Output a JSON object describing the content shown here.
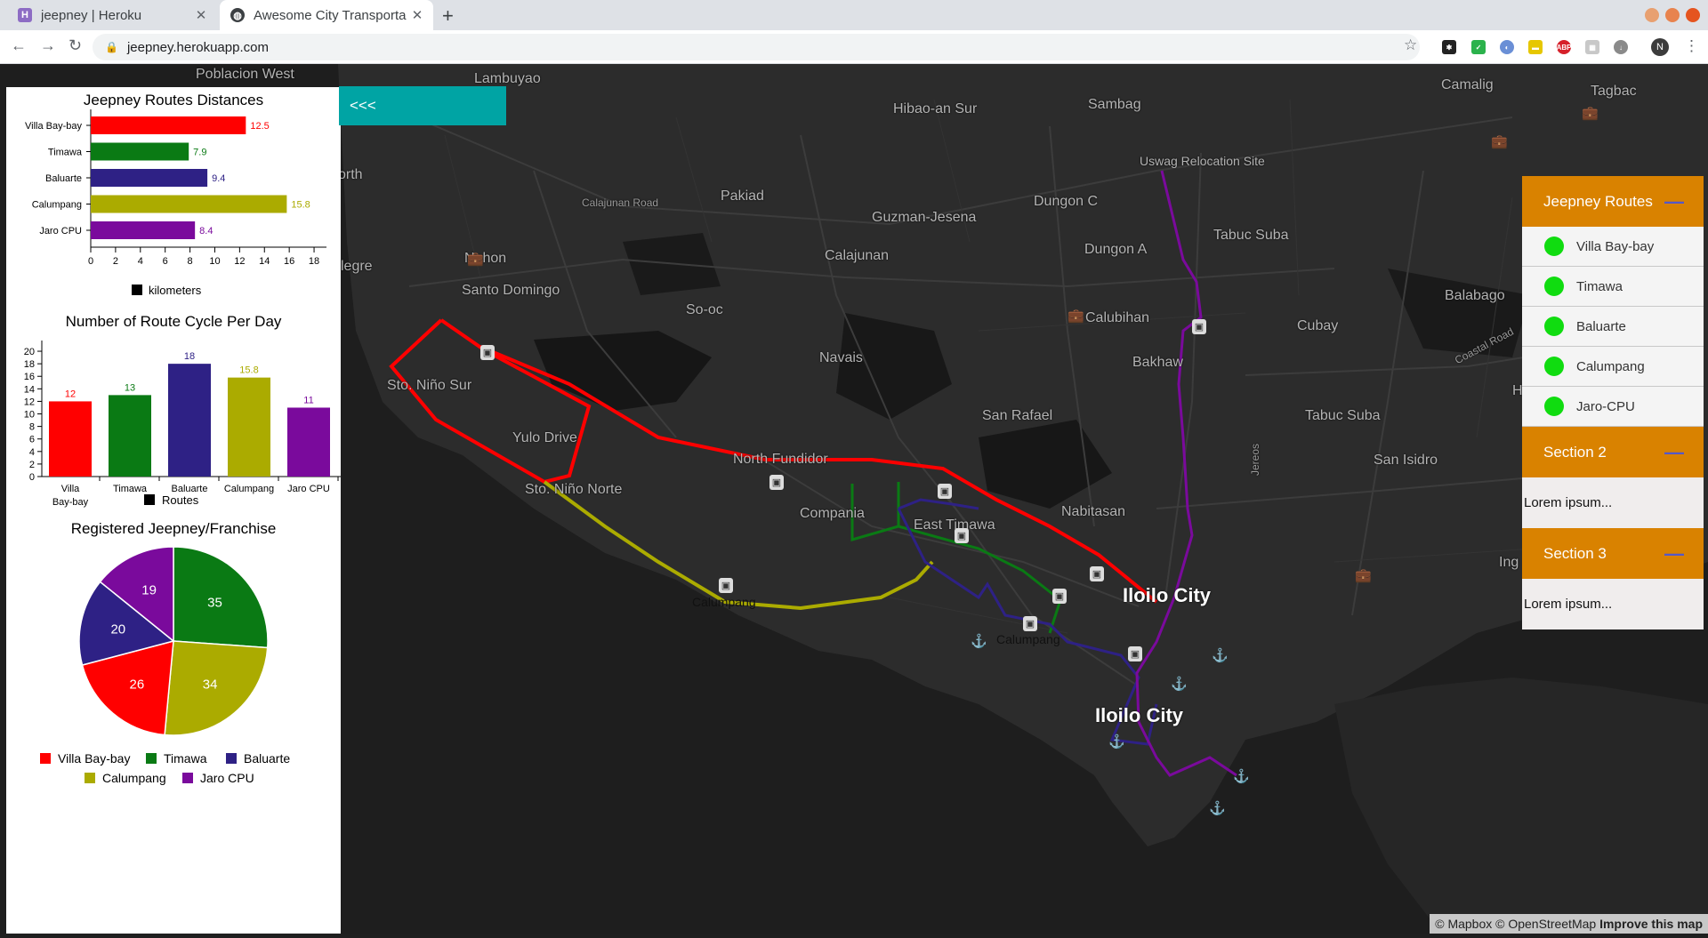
{
  "browser": {
    "tabs": [
      {
        "title": "jeepney | Heroku",
        "favicon": "heroku-icon",
        "active": false
      },
      {
        "title": "Awesome City Transporta",
        "favicon": "globe-icon",
        "active": true
      }
    ],
    "url": "jeepney.herokuapp.com",
    "avatar_letter": "N"
  },
  "map": {
    "places": [
      {
        "name": "Poblacion West",
        "cls": ""
      },
      {
        "name": "Lambuyao",
        "cls": ""
      },
      {
        "name": "Hibao-an Sur",
        "cls": ""
      },
      {
        "name": "Sambag",
        "cls": ""
      },
      {
        "name": "Camalig",
        "cls": ""
      },
      {
        "name": "Tagbac",
        "cls": ""
      },
      {
        "name": "Uswag Relocation Site",
        "cls": "small"
      },
      {
        "name": "orth",
        "cls": ""
      },
      {
        "name": "Pakiad",
        "cls": ""
      },
      {
        "name": "Calajunan Road",
        "cls": "road"
      },
      {
        "name": "Dungon C",
        "cls": ""
      },
      {
        "name": "Guzman-Jesena",
        "cls": ""
      },
      {
        "name": "Tabuc Suba",
        "cls": ""
      },
      {
        "name": "Calajunan",
        "cls": ""
      },
      {
        "name": "Dungon A",
        "cls": ""
      },
      {
        "name": "legre",
        "cls": ""
      },
      {
        "name": "Nahon",
        "cls": ""
      },
      {
        "name": "Santo Domingo",
        "cls": ""
      },
      {
        "name": "Balabago",
        "cls": ""
      },
      {
        "name": "So-oc",
        "cls": ""
      },
      {
        "name": "Calubihan",
        "cls": ""
      },
      {
        "name": "Cubay",
        "cls": ""
      },
      {
        "name": "Coastal Road",
        "cls": "road"
      },
      {
        "name": "Navais",
        "cls": ""
      },
      {
        "name": "Bakhaw",
        "cls": ""
      },
      {
        "name": "Sto. Niño Sur",
        "cls": ""
      },
      {
        "name": "Hinac",
        "cls": ""
      },
      {
        "name": "San Rafael",
        "cls": ""
      },
      {
        "name": "Tabuc Suba",
        "cls": ""
      },
      {
        "name": "Jereos",
        "cls": "road"
      },
      {
        "name": "Yulo Drive",
        "cls": ""
      },
      {
        "name": "North Fundidor",
        "cls": ""
      },
      {
        "name": "San Isidro",
        "cls": ""
      },
      {
        "name": "Sto. Niño Norte",
        "cls": ""
      },
      {
        "name": "Nabitasan",
        "cls": ""
      },
      {
        "name": "Compania",
        "cls": ""
      },
      {
        "name": "East Timawa",
        "cls": ""
      },
      {
        "name": "Ing",
        "cls": ""
      },
      {
        "name": "Iloilo City",
        "cls": "city"
      },
      {
        "name": "Calumpang",
        "cls": "term"
      },
      {
        "name": "Calumpang",
        "cls": "term"
      },
      {
        "name": "Iloilo City",
        "cls": "city"
      }
    ],
    "attribution_prefix": "© Mapbox © OpenStreetMap",
    "attribution_link": "Improve this map"
  },
  "panel_toggle_label": "<<<",
  "colors": {
    "Villa Bay-bay": "#ff0000",
    "Timawa": "#0a7a14",
    "Baluarte": "#2e2185",
    "Calumpang": "#abab00",
    "Jaro CPU": "#7a0a9c"
  },
  "chart_data": [
    {
      "type": "bar",
      "orientation": "horizontal",
      "title": "Jeepney Routes Distances",
      "categories": [
        "Villa Bay-bay",
        "Timawa",
        "Baluarte",
        "Calumpang",
        "Jaro CPU"
      ],
      "values": [
        12.5,
        7.9,
        9.4,
        15.8,
        8.4
      ],
      "xlim": [
        0,
        19
      ],
      "xticks": [
        0,
        2,
        4,
        6,
        8,
        10,
        12,
        14,
        16,
        18
      ],
      "legend": "kilometers",
      "legend_position": "bottom"
    },
    {
      "type": "bar",
      "orientation": "vertical",
      "title": "Number of Route Cycle Per Day",
      "categories": [
        "Villa Bay-bay",
        "Timawa",
        "Baluarte",
        "Calumpang",
        "Jaro CPU"
      ],
      "values": [
        12,
        13,
        18,
        15.8,
        11
      ],
      "ylim": [
        0,
        21
      ],
      "yticks": [
        0,
        2,
        4,
        6,
        8,
        10,
        12,
        14,
        16,
        18,
        20
      ],
      "legend": "Routes",
      "legend_position": "bottom"
    },
    {
      "type": "pie",
      "title": "Registered Jeepney/Franchise",
      "slices": [
        {
          "label": "Timawa",
          "value": 35
        },
        {
          "label": "Calumpang",
          "value": 34
        },
        {
          "label": "Villa Bay-bay",
          "value": 26
        },
        {
          "label": "Baluarte",
          "value": 20
        },
        {
          "label": "Jaro CPU",
          "value": 19
        }
      ],
      "legend": [
        "Villa Bay-bay",
        "Timawa",
        "Baluarte",
        "Calumpang",
        "Jaro CPU"
      ],
      "legend_position": "bottom"
    }
  ],
  "right_panel": {
    "sections": [
      {
        "title": "Jeepney Routes",
        "items": [
          "Villa Bay-bay",
          "Timawa",
          "Baluarte",
          "Calumpang",
          "Jaro-CPU"
        ]
      },
      {
        "title": "Section 2",
        "body": "Lorem ipsum..."
      },
      {
        "title": "Section 3",
        "body": "Lorem ipsum..."
      }
    ]
  }
}
